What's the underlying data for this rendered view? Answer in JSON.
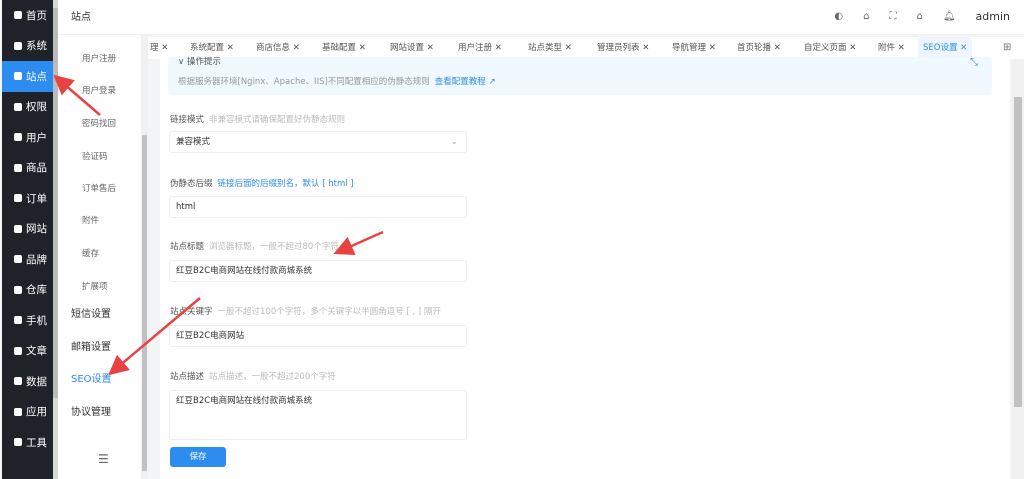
{
  "sidebar": {
    "items": [
      {
        "label": "首页",
        "icon": "home-icon"
      },
      {
        "label": "系统",
        "icon": "gear-icon"
      },
      {
        "label": "站点",
        "icon": "sliders-icon",
        "active": true
      },
      {
        "label": "权限",
        "icon": "user-lock-icon"
      },
      {
        "label": "用户",
        "icon": "user-icon"
      },
      {
        "label": "商品",
        "icon": "goods-icon"
      },
      {
        "label": "订单",
        "icon": "order-icon"
      },
      {
        "label": "网站",
        "icon": "website-icon"
      },
      {
        "label": "品牌",
        "icon": "brand-icon"
      },
      {
        "label": "仓库",
        "icon": "warehouse-icon"
      },
      {
        "label": "手机",
        "icon": "phone-icon"
      },
      {
        "label": "文章",
        "icon": "article-icon"
      },
      {
        "label": "数据",
        "icon": "chart-icon"
      },
      {
        "label": "应用",
        "icon": "apps-icon"
      },
      {
        "label": "工具",
        "icon": "wrench-icon"
      }
    ]
  },
  "submenu": {
    "title": "站点",
    "children": [
      "用户注册",
      "用户登录",
      "密码找回",
      "验证码",
      "订单售后",
      "附件",
      "缓存",
      "扩展项"
    ],
    "parents": [
      "短信设置",
      "邮箱设置",
      "SEO设置",
      "协议管理"
    ],
    "active": "SEO设置"
  },
  "header": {
    "user": "admin",
    "icons": [
      "palette-icon",
      "store-icon",
      "fullscreen-icon",
      "home-icon",
      "bell-icon"
    ]
  },
  "tabs": [
    "理",
    "系统配置",
    "商店信息",
    "基础配置",
    "网站设置",
    "用户注册",
    "站点类型",
    "管理员列表",
    "导航管理",
    "首页轮播",
    "自定义页面",
    "附件",
    "SEO设置"
  ],
  "notice": {
    "title": "操作提示",
    "text": "根据服务器环境[Nginx、Apache、IIS]不同配置相应的伪静态规则",
    "link": "查看配置教程"
  },
  "form": {
    "link_mode": {
      "label": "链接模式",
      "hint": "非兼容模式请确保配置好伪静态规则",
      "value": "兼容模式"
    },
    "suffix": {
      "label": "伪静态后缀",
      "hint": "链接后面的后缀别名，默认 [ html ]",
      "value": "html"
    },
    "title": {
      "label": "站点标题",
      "hint": "浏览器标题，一般不超过80个字符",
      "value": "红豆B2C电商网站在线付款商城系统"
    },
    "keywords": {
      "label": "站点关键字",
      "hint": "一般不超过100个字符，多个关键字以半圆角逗号 [ , ] 隔开",
      "value": "红豆B2C电商网站"
    },
    "description": {
      "label": "站点描述",
      "hint": "站点描述，一般不超过200个字符",
      "value": "红豆B2C电商网站在线付款商城系统"
    },
    "save": "保存"
  },
  "colors": {
    "accent": "#2d8cf0",
    "sidebar": "#1f2229",
    "annotation": "#e84343"
  }
}
